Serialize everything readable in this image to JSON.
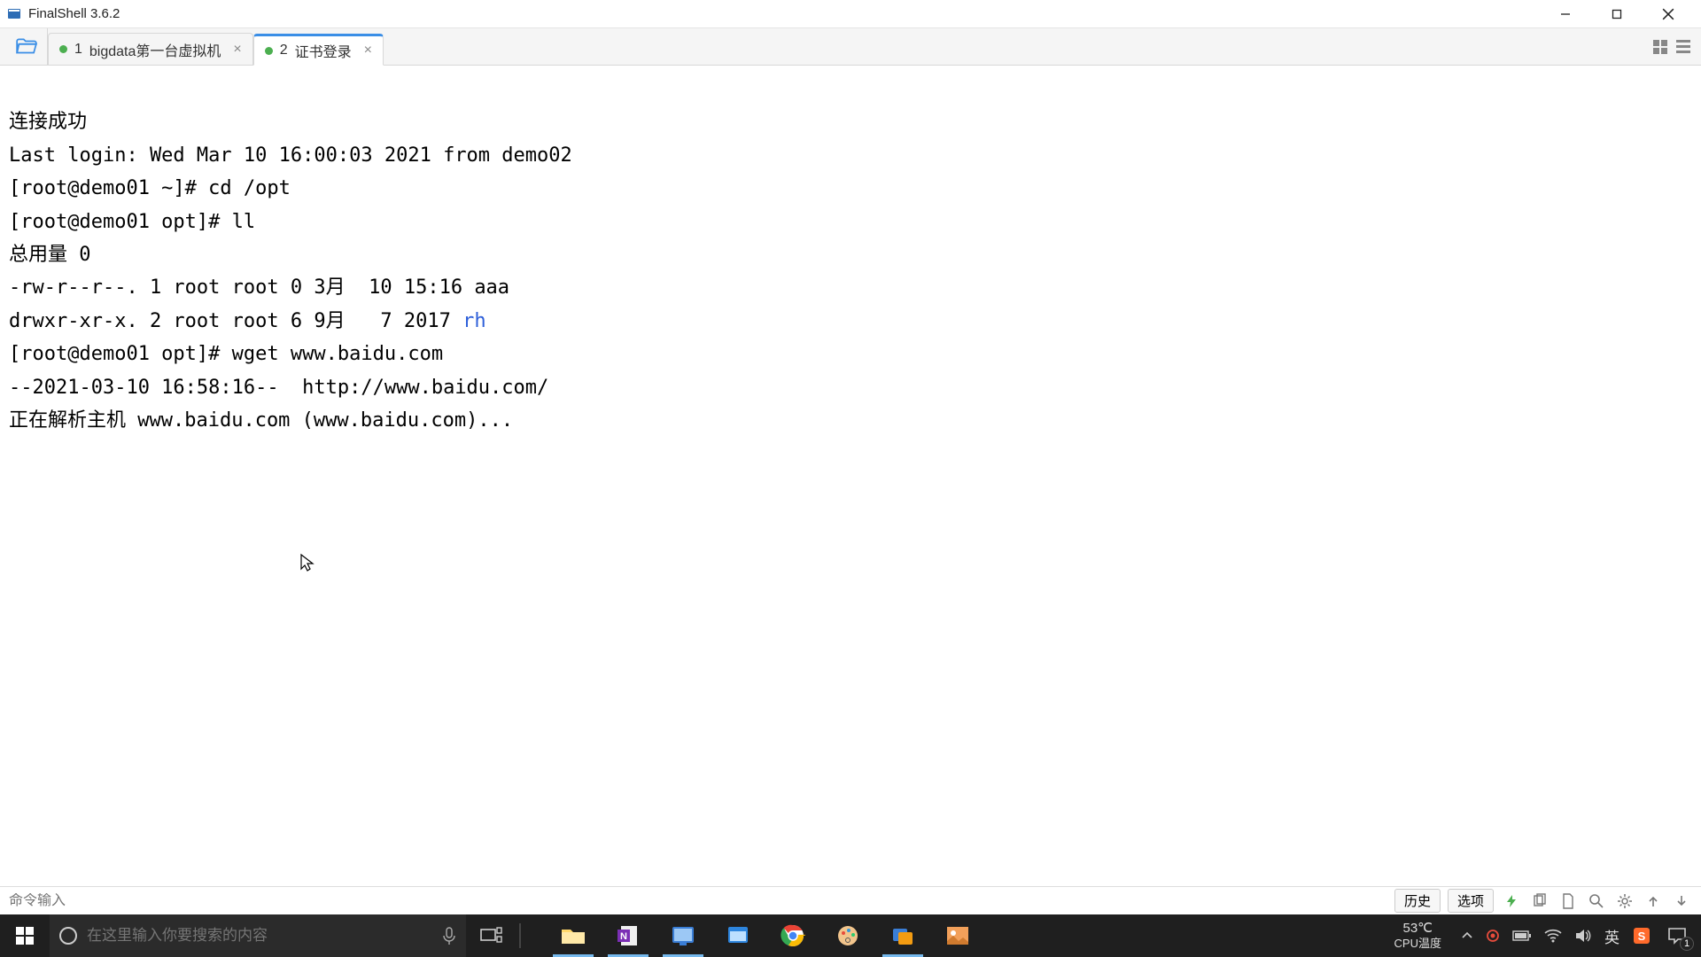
{
  "window": {
    "title": "FinalShell 3.6.2"
  },
  "tabs": [
    {
      "index": "1",
      "label": "bigdata第一台虚拟机",
      "active": false
    },
    {
      "index": "2",
      "label": "证书登录",
      "active": true
    }
  ],
  "terminal": {
    "lines": [
      {
        "text": "连接成功"
      },
      {
        "text": "Last login: Wed Mar 10 16:00:03 2021 from demo02"
      },
      {
        "text": "[root@demo01 ~]# cd /opt"
      },
      {
        "text": "[root@demo01 opt]# ll"
      },
      {
        "text": "总用量 0"
      },
      {
        "text": "-rw-r--r--. 1 root root 0 3月  10 15:16 aaa"
      },
      {
        "prefix": "drwxr-xr-x. 2 root root 6 9月   7 2017 ",
        "link": "rh"
      },
      {
        "text": "[root@demo01 opt]# wget www.baidu.com"
      },
      {
        "text": "--2021-03-10 16:58:16--  http://www.baidu.com/"
      },
      {
        "text": "正在解析主机 www.baidu.com (www.baidu.com)..."
      }
    ]
  },
  "cmdbar": {
    "placeholder": "命令输入",
    "history": "历史",
    "options": "选项"
  },
  "taskbar": {
    "search_placeholder": "在这里输入你要搜索的内容",
    "temp": "53℃",
    "temp_label": "CPU温度",
    "ime": "英",
    "notif_count": "1"
  }
}
